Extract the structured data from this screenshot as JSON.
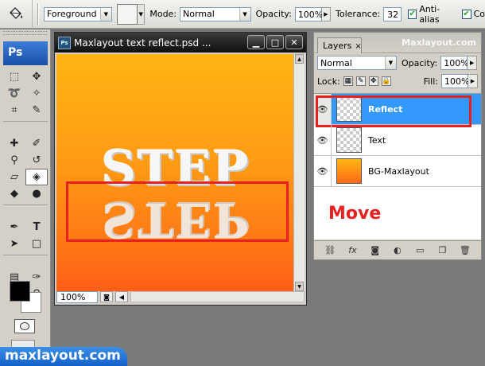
{
  "options_bar": {
    "tool_icon": "paint-bucket-icon",
    "fill_source": "Foreground",
    "mode_label": "Mode:",
    "mode_value": "Normal",
    "opacity_label": "Opacity:",
    "opacity_value": "100%",
    "tolerance_label": "Tolerance:",
    "tolerance_value": "32",
    "antialias_label": "Anti-alias",
    "antialias_checked": true,
    "contiguous_label": "Co",
    "contiguous_checked": true
  },
  "toolbox": {
    "logo": "Ps",
    "selected_tool": "paint-bucket-tool"
  },
  "document": {
    "title": "Maxlayout text reflect.psd ...",
    "zoom": "100%",
    "canvas_text": "STEP",
    "reflection_text": "STEP"
  },
  "layers_panel": {
    "tab_label": "Layers",
    "tab_close": "×",
    "watermark": "Maxlayout.com",
    "blend_mode": "Normal",
    "opacity_label": "Opacity:",
    "opacity_value": "100%",
    "lock_label": "Lock:",
    "fill_label": "Fill:",
    "fill_value": "100%",
    "layers": [
      {
        "name": "Reflect",
        "selected": true
      },
      {
        "name": "Text",
        "selected": false
      },
      {
        "name": "BG-Maxlayout",
        "selected": false
      }
    ],
    "annotation": "Move"
  },
  "brand": "maxlayout.com",
  "colors": {
    "accent_red": "#e8201f",
    "selection_blue": "#3399ff",
    "canvas_top": "#ffb513",
    "canvas_bottom": "#ff5f16"
  }
}
